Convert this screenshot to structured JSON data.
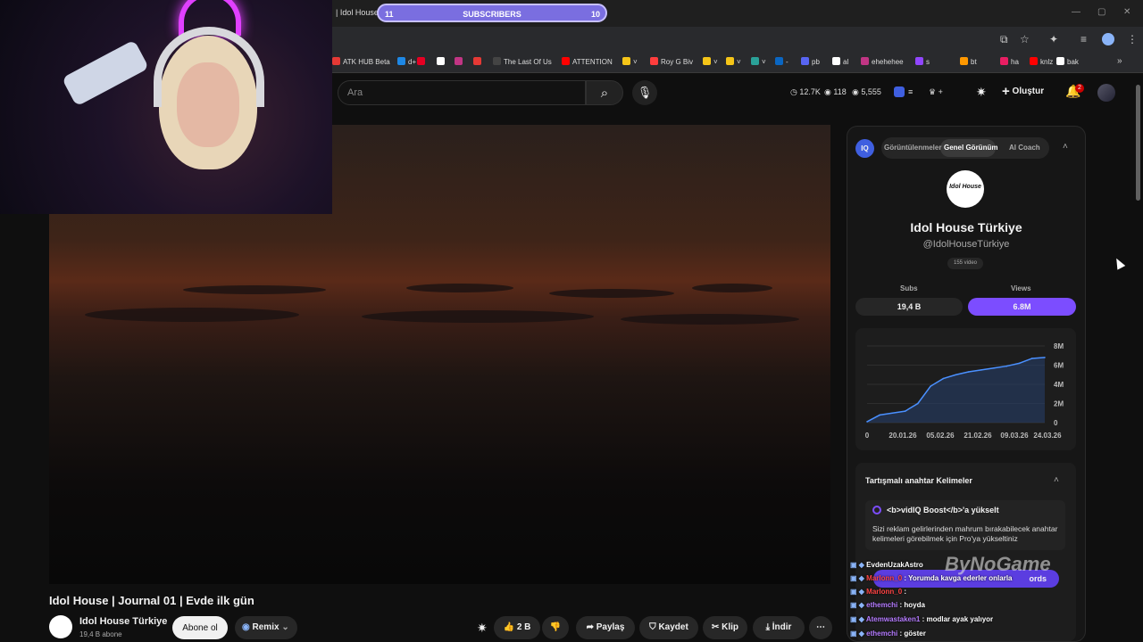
{
  "browser": {
    "tab_title": "| Idol House |",
    "subscriber_goal": {
      "current": "11",
      "label": "SUBSCRIBERS",
      "target": "10"
    },
    "window_controls": [
      "—",
      "▢",
      "✕"
    ]
  },
  "bookmarks": [
    {
      "label": "ATK HUB Beta",
      "color": "#e53935"
    },
    {
      "label": "d+",
      "color": "#1e88e5"
    },
    {
      "label": "",
      "color": "#e60023"
    },
    {
      "label": "",
      "color": "#ffffff"
    },
    {
      "label": "",
      "color": "#c13584"
    },
    {
      "label": "",
      "color": "#e53935"
    },
    {
      "label": "The Last Of Us",
      "color": "#444444"
    },
    {
      "label": "ATTENTION",
      "color": "#ff0000"
    },
    {
      "label": "˅",
      "color": "#f5c518"
    },
    {
      "label": "Roy G Biv",
      "color": "#ff3d3d"
    },
    {
      "label": "˅",
      "color": "#f5c518"
    },
    {
      "label": "˅",
      "color": "#f5c518"
    },
    {
      "label": "˅",
      "color": "#2aa198"
    },
    {
      "label": "-",
      "color": "#0a66c2"
    },
    {
      "label": "pb",
      "color": "#5865f2"
    },
    {
      "label": "al",
      "color": "#ffffff"
    },
    {
      "label": "ehehehee",
      "color": "#c13584"
    },
    {
      "label": "s",
      "color": "#9146ff"
    },
    {
      "label": "bt",
      "color": "#ff9800"
    },
    {
      "label": "ha",
      "color": "#e91e63"
    },
    {
      "label": "knlz",
      "color": "#ff0000"
    },
    {
      "label": "bak",
      "color": "#ffffff"
    }
  ],
  "youtube": {
    "search_placeholder": "Ara",
    "stats": {
      "views": "12.7K",
      "eyes": "118",
      "subs": "5,555"
    },
    "create_label": "Oluştur",
    "notifications": "2"
  },
  "video": {
    "title": "Idol House | Journal 01 | Evde ilk gün",
    "channel": "Idol House Türkiye",
    "channel_subs": "19,4 B abone",
    "subscribe_label": "Abone ol",
    "remix_label": "Remix",
    "likes": "2 B",
    "share_label": "Paylaş",
    "save_label": "Kaydet",
    "clip_label": "Klip",
    "download_label": "İndir"
  },
  "vidiq": {
    "badge": "IQ",
    "tabs": [
      "Görüntülenmeler",
      "Genel Görünüm",
      "AI Coach"
    ],
    "active_tab": 1,
    "channel_logo_text": "Idol House",
    "channel_name": "Idol House Türkiye",
    "handle": "@IdolHouseTürkiye",
    "video_count": "155 video",
    "subs_label": "Subs",
    "subs_value": "19,4 B",
    "views_label": "Views",
    "views_value": "6.8M",
    "keywords_title": "Tartışmalı anahtar Kelimeler",
    "boost_title": "<b>vidIQ Boost</b>'a yükselt",
    "boost_text": "Sizi reklam gelirlerinden mahrum bırakabilecek anahtar kelimeleri görebilmek için Pro'ya yükseltiniz",
    "keywords_button": "ords"
  },
  "chart_data": {
    "type": "line",
    "x": [
      "0",
      "20.01.26",
      "05.02.26",
      "21.02.26",
      "09.03.26",
      "24.03.26"
    ],
    "y_ticks": [
      "0",
      "2M",
      "4M",
      "6M",
      "8M"
    ],
    "ylim": [
      0,
      8
    ],
    "series": [
      {
        "values": [
          0.1,
          0.8,
          1.0,
          1.2,
          2.0,
          3.8,
          4.6,
          5.0,
          5.3,
          5.5,
          5.7,
          5.9,
          6.2,
          6.7,
          6.8
        ]
      }
    ],
    "color": "#4a90ff"
  },
  "chat": [
    {
      "user": "EvdenUzakAstro",
      "msg": "",
      "color": "#ffffff"
    },
    {
      "user": "Marlonn_0",
      "msg": ": Yorumda kavga ederler onlarla",
      "color": "#ff4444"
    },
    {
      "user": "Marlonn_0",
      "msg": ":",
      "color": "#ff4444"
    },
    {
      "user": "ethemchi",
      "msg": ": hoyda",
      "color": "#b57bff"
    },
    {
      "user": "Atemwastaken1",
      "msg": ": modlar ayak yalıyor",
      "color": "#b57bff"
    },
    {
      "user": "ethemchi",
      "msg": ": göster",
      "color": "#b57bff"
    }
  ],
  "watermark": "ByNoGame"
}
